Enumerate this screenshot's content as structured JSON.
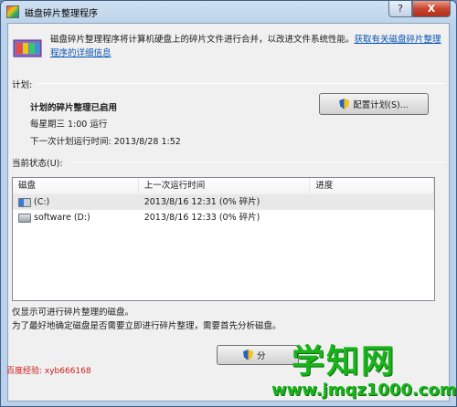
{
  "window": {
    "title": "磁盘碎片整理程序",
    "help_glyph": "?",
    "close_glyph": "X"
  },
  "intro": {
    "text": "磁盘碎片整理程序将计算机硬盘上的碎片文件进行合并，以改进文件系统性能。",
    "link": "获取有关磁盘碎片整理程序的详细信息"
  },
  "schedule": {
    "group_label": "计划:",
    "status": "计划的碎片整理已启用",
    "run_time": "每星期三  1:00 运行",
    "next_run": "下一次计划运行时间: 2013/8/28 1:52",
    "configure_button": "配置计划(S)..."
  },
  "current_status": {
    "group_label": "当前状态(U):",
    "columns": [
      "磁盘",
      "上一次运行时间",
      "进度"
    ],
    "rows": [
      {
        "disk": "(C:)",
        "last_run": "2013/8/16 12:31 (0% 碎片)",
        "progress": ""
      },
      {
        "disk": "software (D:)",
        "last_run": "2013/8/16 12:33 (0% 碎片)",
        "progress": ""
      }
    ]
  },
  "footnotes": {
    "line1": "仅显示可进行碎片整理的磁盘。",
    "line2": "为了最好地确定磁盘是否需要立即进行碎片整理，需要首先分析磁盘。"
  },
  "analyze_button": "分",
  "watermark": "百度经验: xyb666168",
  "brand": {
    "name": "学知网",
    "url": "www.jmqz1000.com"
  },
  "icons": {
    "app": "defrag-icon",
    "shield": "uac-shield-icon",
    "system_drive": "system-drive-icon",
    "drive": "drive-icon"
  }
}
